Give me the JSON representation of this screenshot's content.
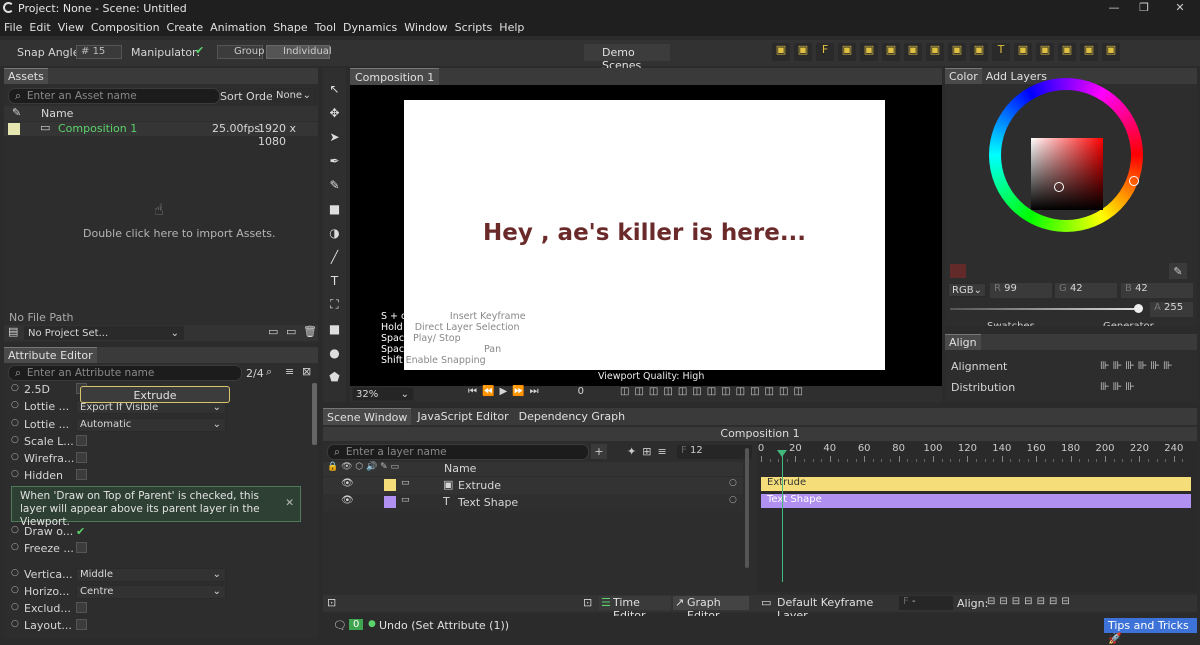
{
  "app": {
    "title": "Project: None - Scene: Untitled"
  },
  "menu": [
    "File",
    "Edit",
    "View",
    "Composition",
    "Create",
    "Animation",
    "Shape",
    "Tool",
    "Dynamics",
    "Window",
    "Scripts",
    "Help"
  ],
  "toolbar": {
    "snap_label": "Snap Angle:",
    "snap_value": "15",
    "manip_label": "Manipulator:",
    "group_label": "Group",
    "individual_label": "Individual",
    "demo_scenes": "Demo Scenes"
  },
  "assets": {
    "tab": "Assets",
    "search_placeholder": "Enter an Asset name",
    "sort_label": "Sort Order",
    "sort_value": "None",
    "col_name": "Name",
    "item_name": "Composition 1",
    "item_fps": "25.00fps",
    "item_res": "1920 x 1080",
    "import_hint": "Double click here to import Assets.",
    "path": "No File Path",
    "project": "No Project Set..."
  },
  "attr": {
    "tab": "Attribute Editor",
    "search_placeholder": "Enter an Attribute name",
    "page": "2/4",
    "tooltip_name": "Extrude",
    "rows": [
      {
        "label": "2.5D"
      },
      {
        "label": "Lottie ...",
        "value": "Export If Visible"
      },
      {
        "label": "Lottie ...",
        "value": "Automatic"
      },
      {
        "label": "Scale L..."
      },
      {
        "label": "Wirefra..."
      },
      {
        "label": "Hidden"
      }
    ],
    "info": "When 'Draw on Top of Parent' is checked, this layer will appear above its parent layer in the Viewport.",
    "rows2": [
      {
        "label": "Draw o..."
      },
      {
        "label": "Freeze ..."
      },
      {
        "label": "Vertica...",
        "value": "Middle"
      },
      {
        "label": "Horizo...",
        "value": "Centre"
      },
      {
        "label": "Exclud..."
      },
      {
        "label": "Layout..."
      }
    ]
  },
  "viewport": {
    "tab": "Composition 1",
    "text": "Hey , ae's killer is here...",
    "hints": [
      {
        "k": "S + click path",
        "v": "Insert Keyframe"
      },
      {
        "k": "Hold S",
        "v": "Direct Layer Selection"
      },
      {
        "k": "Space",
        "v": "Play/ Stop"
      },
      {
        "k": "Space + click + drag",
        "v": "Pan"
      },
      {
        "k": "Shift",
        "v": "Enable Snapping"
      }
    ],
    "quality": "Viewport Quality: High",
    "zoom": "32%",
    "frame": "0",
    "text_color": "#6b2a2a"
  },
  "color": {
    "tab_color": "Color",
    "tab_layers": "Add Layers",
    "mode": "RGB",
    "r_label": "R",
    "g_label": "G",
    "b_label": "B",
    "a_label": "A",
    "r": "99",
    "g": "42",
    "b": "42",
    "a": "255",
    "swatch": "#632a2a",
    "swatches": "Swatches",
    "generator": "Generator"
  },
  "align": {
    "title": "Align",
    "alignment": "Alignment",
    "distribution": "Distribution"
  },
  "scene": {
    "tabs": [
      "Scene Window",
      "JavaScript Editor",
      "Dependency Graph"
    ],
    "comp_title": "Composition 1",
    "search_placeholder": "Enter a layer name",
    "frame_label": "F",
    "frame_value": "12",
    "col_name": "Name",
    "layers": [
      {
        "name": "Extrude"
      },
      {
        "name": "Text Shape"
      }
    ]
  },
  "timeline": {
    "ticks": [
      "0",
      "20",
      "40",
      "60",
      "80",
      "100",
      "120",
      "140",
      "160",
      "180",
      "200",
      "220",
      "240"
    ],
    "playhead_frame": 12,
    "frame_min": 0,
    "frame_max": 250
  },
  "bottom": {
    "time_editor": "Time Editor",
    "graph_editor": "Graph Editor",
    "default_kf": "Default Keyframe Layer",
    "f_label": "F",
    "f_value": "-",
    "align_label": "Align:"
  },
  "status": {
    "count": "0",
    "message": "Undo (Set Attribute (1))",
    "tips": "Tips and Tricks"
  }
}
